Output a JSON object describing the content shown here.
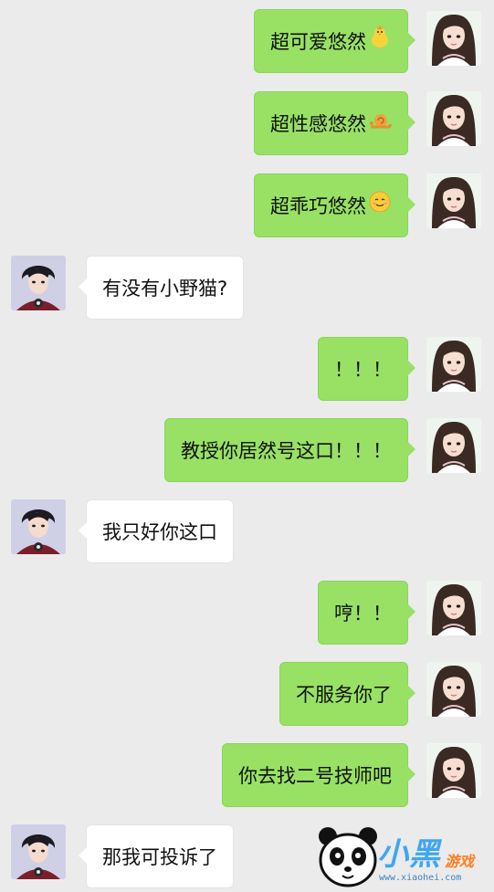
{
  "messages": [
    {
      "side": "sent",
      "text": "超可爱悠然",
      "emoji": "chick-emoji"
    },
    {
      "side": "sent",
      "text": "超性感悠然",
      "emoji": "snail-emoji"
    },
    {
      "side": "sent",
      "text": "超乖巧悠然",
      "emoji": "smile-emoji"
    },
    {
      "side": "received",
      "text": "有没有小野猫?"
    },
    {
      "side": "sent",
      "text": "！！！"
    },
    {
      "side": "sent",
      "text": "教授你居然号这口！！！"
    },
    {
      "side": "received",
      "text": "我只好你这口"
    },
    {
      "side": "sent",
      "text": "哼！！"
    },
    {
      "side": "sent",
      "text": "不服务你了"
    },
    {
      "side": "sent",
      "text": "你去找二号技师吧"
    },
    {
      "side": "received",
      "text": "那我可投诉了"
    }
  ],
  "watermark": {
    "title": "小黑",
    "subtitle": "游戏",
    "url": "www.xiaohei.com"
  },
  "colors": {
    "background": "#ebebeb",
    "sent_bubble": "#98e165",
    "received_bubble": "#ffffff",
    "watermark_blue": "#3fa7f0",
    "watermark_orange": "#ff7d20"
  }
}
